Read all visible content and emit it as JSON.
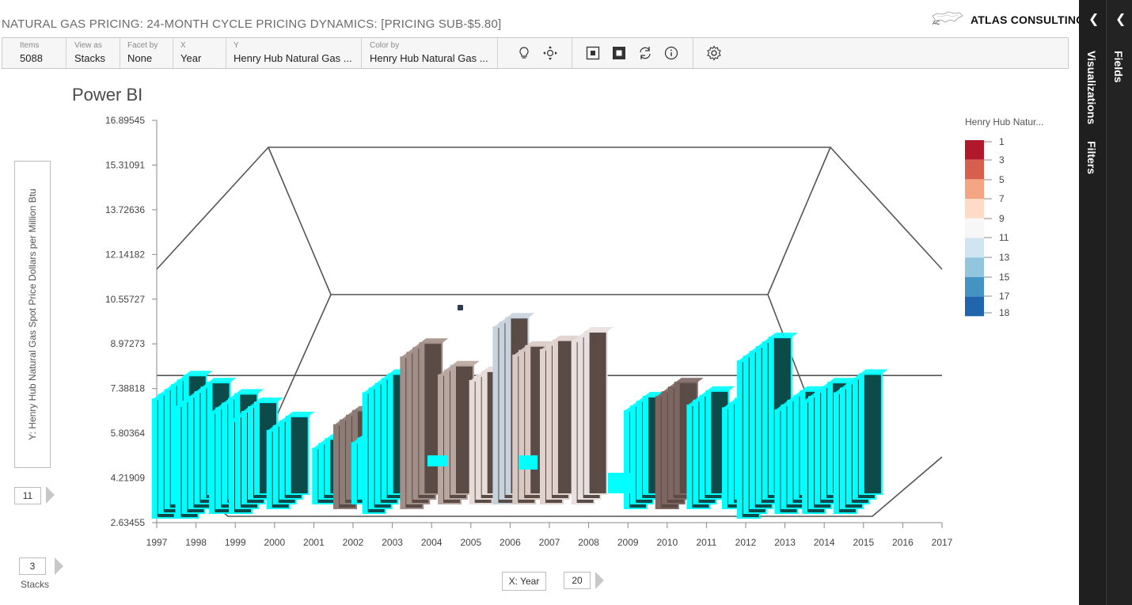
{
  "title": "NATURAL GAS PRICING: 24-MONTH CYCLE PRICING DYNAMICS: [PRICING SUB-$5.80]",
  "logo": {
    "name": "ATLAS CONSULTING",
    "mark": "AC"
  },
  "toolbar": {
    "fields": [
      {
        "label": "Items",
        "value": "5088"
      },
      {
        "label": "View as",
        "value": "Stacks"
      },
      {
        "label": "Facet by",
        "value": "None"
      },
      {
        "label": "X",
        "value": "Year"
      },
      {
        "label": "Y",
        "value": "Henry Hub Natural Gas ..."
      },
      {
        "label": "Color by",
        "value": "Henry Hub Natural Gas ..."
      }
    ],
    "icons": [
      "lightbulb-icon",
      "move-icon",
      "select-box-icon",
      "filled-box-icon",
      "refresh-icon",
      "info-icon",
      "settings-icon"
    ]
  },
  "side_panels": {
    "visualizations": "Visualizations",
    "filters": "Filters",
    "fields": "Fields"
  },
  "chart_heading": "Power BI",
  "y_axis_title": "Y: Henry Hub Natural Gas Spot Price Dollars per Million Btu",
  "controls": {
    "y_bins": "11",
    "stacks_count": "3",
    "stacks_label": "Stacks",
    "x_axis_button": "X: Year",
    "x_bins": "20"
  },
  "chart_data": {
    "type": "bar",
    "title": "Power BI",
    "ylabel": "Y: Henry Hub Natural Gas Spot Price Dollars per Million Btu",
    "xlabel": "X: Year",
    "y_ticks": [
      "16.89545",
      "15.31091",
      "13.72636",
      "12.14182",
      "10.55727",
      "8.97273",
      "7.38818",
      "5.80364",
      "4.21909",
      "2.63455"
    ],
    "x_ticks": [
      "1997",
      "1998",
      "1999",
      "2000",
      "2001",
      "2002",
      "2003",
      "2004",
      "2005",
      "2006",
      "2007",
      "2008",
      "2009",
      "2010",
      "2011",
      "2012",
      "2013",
      "2014",
      "2015",
      "2016",
      "2017"
    ],
    "ylim": [
      2.63455,
      16.89545
    ],
    "xlim": [
      1997,
      2017
    ],
    "reference_line": 7.85,
    "legend": {
      "title": "Henry Hub Natur...",
      "labels": [
        "1",
        "3",
        "5",
        "7",
        "9",
        "11",
        "13",
        "15",
        "17",
        "18"
      ],
      "colors": [
        "#b2182b",
        "#d6604d",
        "#f4a582",
        "#fddbc7",
        "#f7f7f7",
        "#d1e5f0",
        "#92c5de",
        "#4393c3",
        "#2166ac",
        "#2166ac"
      ]
    },
    "highlight_color": "#00ffff",
    "columns": [
      {
        "x": 1997.7,
        "top": 7.85,
        "depth": 6,
        "hl": true
      },
      {
        "x": 1998.3,
        "top": 7.6,
        "depth": 6,
        "hl": true
      },
      {
        "x": 1999.0,
        "top": 7.2,
        "depth": 5,
        "hl": true
      },
      {
        "x": 1999.5,
        "top": 6.9,
        "depth": 5,
        "hl": true
      },
      {
        "x": 2000.3,
        "top": 6.4,
        "depth": 4,
        "hl": true
      },
      {
        "x": 2001.3,
        "top": 5.6,
        "depth": 3,
        "hl": true
      },
      {
        "x": 2002.0,
        "top": 6.6,
        "depth": 4,
        "hl": false,
        "color": "#8d7b75"
      },
      {
        "x": 2002.3,
        "top": 5.8,
        "depth": 3,
        "hl": true
      },
      {
        "x": 2002.9,
        "top": 7.9,
        "depth": 5,
        "hl": true
      },
      {
        "x": 2003.7,
        "top": 9.0,
        "depth": 4,
        "hl": false,
        "color": "#a38f89"
      },
      {
        "x": 2004.5,
        "top": 8.2,
        "depth": 3,
        "hl": false,
        "color": "#b9a6a0"
      },
      {
        "x": 2005.3,
        "top": 8.0,
        "depth": 3,
        "hl": false,
        "color": "#e6dcd8"
      },
      {
        "x": 2005.9,
        "top": 9.9,
        "depth": 3,
        "hl": false,
        "color": "#c7d3dc"
      },
      {
        "x": 2006.4,
        "top": 8.9,
        "depth": 3,
        "hl": false,
        "color": "#d8c9c3"
      },
      {
        "x": 2007.1,
        "top": 9.1,
        "depth": 3,
        "hl": false,
        "color": "#e0d2cd"
      },
      {
        "x": 2007.9,
        "top": 9.4,
        "depth": 3,
        "hl": false,
        "color": "#e8e0de"
      },
      {
        "x": 2009.4,
        "top": 7.1,
        "depth": 4,
        "hl": true
      },
      {
        "x": 2010.2,
        "top": 7.6,
        "depth": 4,
        "hl": false,
        "color": "#7d6661"
      },
      {
        "x": 2011.0,
        "top": 7.3,
        "depth": 4,
        "hl": true
      },
      {
        "x": 2011.9,
        "top": 7.2,
        "depth": 4,
        "hl": true
      },
      {
        "x": 2012.6,
        "top": 9.2,
        "depth": 6,
        "hl": true
      },
      {
        "x": 2013.4,
        "top": 7.3,
        "depth": 5,
        "hl": true
      },
      {
        "x": 2014.1,
        "top": 7.6,
        "depth": 5,
        "hl": true
      },
      {
        "x": 2014.9,
        "top": 7.9,
        "depth": 5,
        "hl": true
      }
    ]
  }
}
